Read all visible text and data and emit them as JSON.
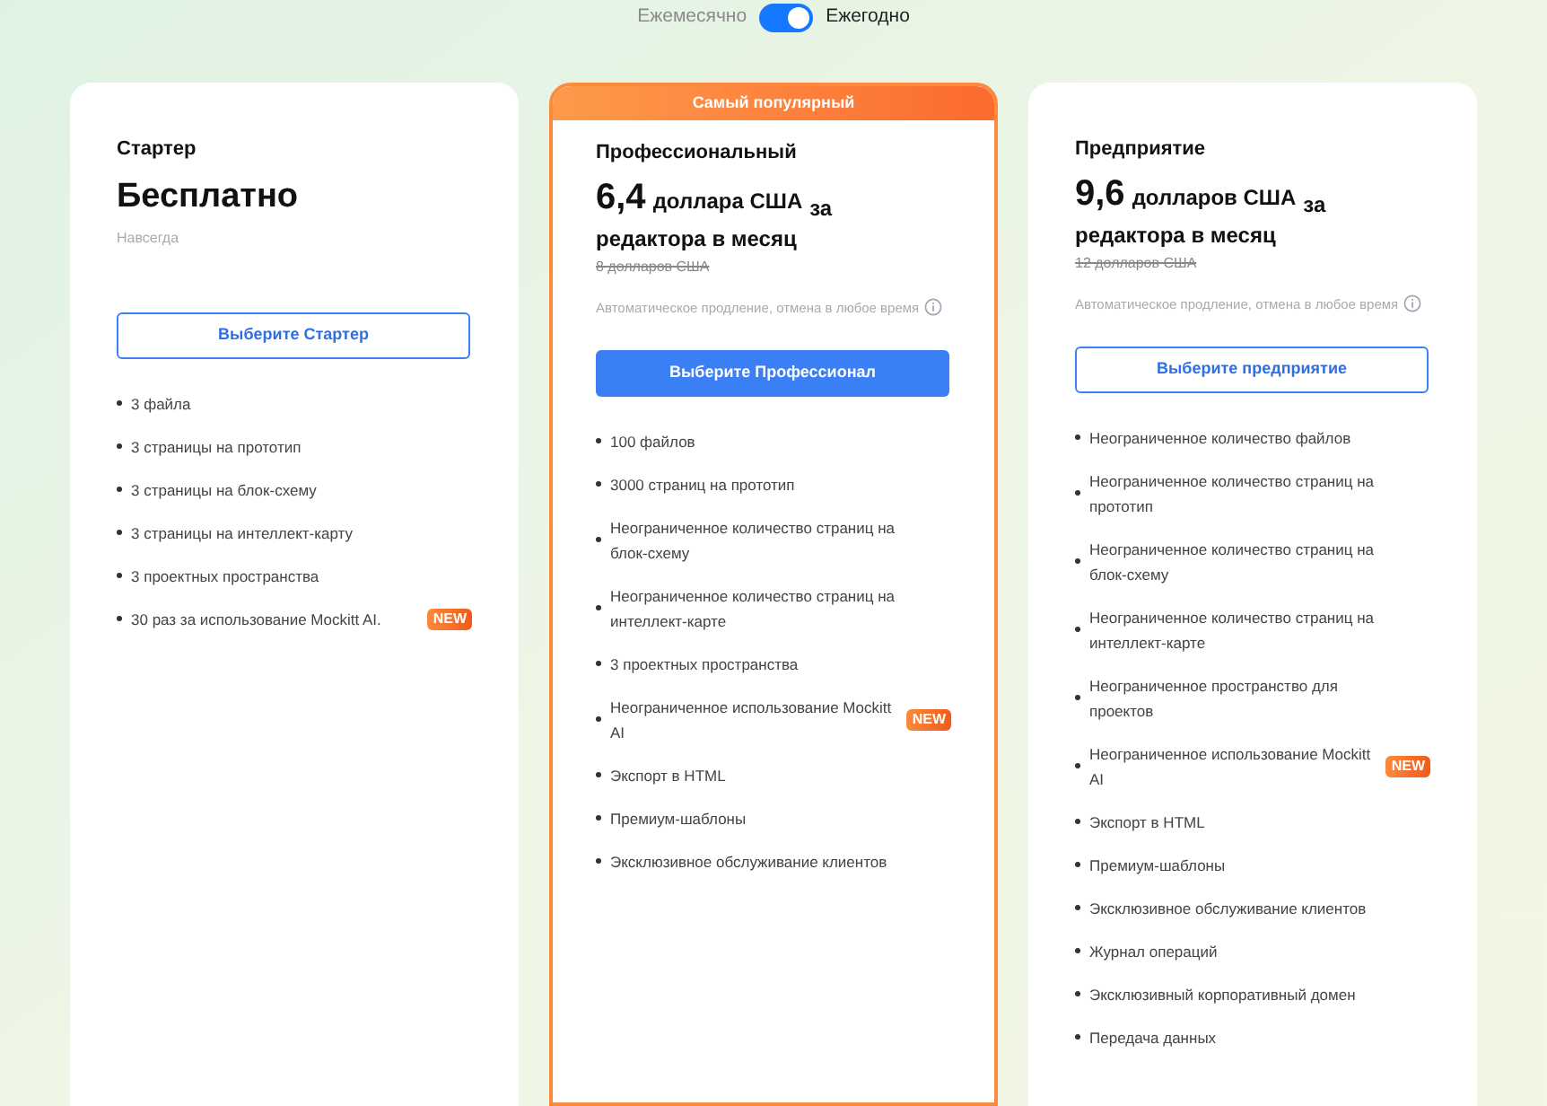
{
  "billing_toggle": {
    "monthly_label": "Ежемесячно",
    "yearly_label": "Ежегодно",
    "yearly_on": true
  },
  "plans": [
    {
      "kind": "free",
      "popular": false,
      "name": "Стартер",
      "price": "Бесплатно",
      "period": "Навсегда",
      "button": {
        "label": "Выберите Стартер"
      },
      "features": [
        {
          "text": "3 файла"
        },
        {
          "text": "3 страницы на прототип"
        },
        {
          "text": "3 страницы на блок-схему"
        },
        {
          "text": "3 страницы на интеллект-карту"
        },
        {
          "text": "3 проектных пространства"
        },
        {
          "text": "30 раз за использование Mockitt AI.",
          "badge": "NEW"
        }
      ]
    },
    {
      "kind": "paid",
      "popular": true,
      "banner": "Самый популярный",
      "name": "Профессиональный",
      "price": "6,4",
      "unit": "доллара США",
      "per": "за",
      "per_line": "редактора в месяц",
      "old_price": "8 долларов США",
      "note": "Автоматическое продление, отмена в любое время",
      "button": {
        "label": "Выберите Профессионал"
      },
      "features": [
        {
          "text": "100 файлов"
        },
        {
          "text": "3000 страниц на прототип"
        },
        {
          "text": "Неограниченное количество страниц на блок-схему"
        },
        {
          "text": "Неограниченное количество страниц на интеллект-карте"
        },
        {
          "text": "3 проектных пространства"
        },
        {
          "text": "Неограниченное использование Mockitt AI",
          "badge": "NEW"
        },
        {
          "text": "Экспорт в HTML"
        },
        {
          "text": "Премиум-шаблоны"
        },
        {
          "text": "Эксклюзивное обслуживание клиентов"
        }
      ]
    },
    {
      "kind": "paid",
      "popular": false,
      "name": "Предприятие",
      "price": "9,6",
      "unit": "долларов США",
      "per": "за",
      "per_line": "редактора в месяц",
      "old_price": "12 долларов США",
      "note": "Автоматическое продление, отмена в любое время",
      "button": {
        "label": "Выберите предприятие"
      },
      "features": [
        {
          "text": "Неограниченное количество файлов"
        },
        {
          "text": "Неограниченное количество страниц на прототип"
        },
        {
          "text": "Неограниченное количество страниц на блок-схему"
        },
        {
          "text": "Неограниченное количество страниц на интеллект-карте"
        },
        {
          "text": "Неограниченное пространство для проектов"
        },
        {
          "text": "Неограниченное использование Mockitt AI",
          "badge": "NEW"
        },
        {
          "text": "Экспорт в HTML"
        },
        {
          "text": "Премиум-шаблоны"
        },
        {
          "text": "Эксклюзивное обслуживание клиентов"
        },
        {
          "text": "Журнал операций"
        },
        {
          "text": "Эксклюзивный корпоративный домен"
        },
        {
          "text": "Передача данных"
        }
      ]
    }
  ]
}
